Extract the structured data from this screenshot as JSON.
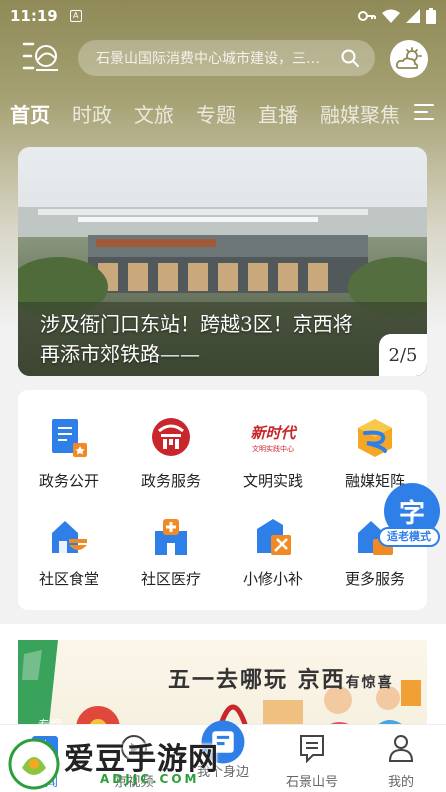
{
  "status_bar": {
    "time": "11:19",
    "notification_letter": "A"
  },
  "header": {
    "search_placeholder": "石景山国际消费中心城市建设，三…"
  },
  "tabs": [
    {
      "label": "首页",
      "active": true
    },
    {
      "label": "时政"
    },
    {
      "label": "文旅"
    },
    {
      "label": "专题"
    },
    {
      "label": "直播"
    },
    {
      "label": "融媒聚焦"
    }
  ],
  "banner": {
    "caption": "涉及衙门口东站！跨越3区！京西将再添市郊铁路——",
    "counter": "2/5"
  },
  "services": [
    {
      "label": "政务公开",
      "icon": "document-icon"
    },
    {
      "label": "政务服务",
      "icon": "hall-icon"
    },
    {
      "label": "文明实践",
      "icon": "civilization-icon"
    },
    {
      "label": "融媒矩阵",
      "icon": "matrix-icon"
    },
    {
      "label": "社区食堂",
      "icon": "canteen-icon"
    },
    {
      "label": "社区医疗",
      "icon": "medical-icon"
    },
    {
      "label": "小修小补",
      "icon": "repair-icon"
    },
    {
      "label": "更多服务",
      "icon": "more-icon"
    }
  ],
  "civilization_icon_text": {
    "line1": "新时代",
    "line2": "文明实践中心"
  },
  "elder_mode": {
    "glyph": "字",
    "label": "适老模式"
  },
  "ad": {
    "title_main": "五一去哪玩 京西",
    "title_small": "有惊喜",
    "side_text": "专题"
  },
  "bottom_nav": [
    {
      "label": "新闻",
      "icon": "news-icon",
      "active": true
    },
    {
      "label": "京视频",
      "icon": "video-icon"
    },
    {
      "label": "我个身边",
      "icon": "nearby-icon"
    },
    {
      "label": "石景山号",
      "icon": "account-icon"
    },
    {
      "label": "我的",
      "icon": "profile-icon"
    }
  ],
  "watermark": {
    "text": "爱豆手游网",
    "url": "ADJJC.COM"
  },
  "colors": {
    "accent": "#2f7fe8",
    "header_bg": "#8f8a57",
    "service_red": "#c8262b",
    "service_orange": "#f08a24"
  }
}
